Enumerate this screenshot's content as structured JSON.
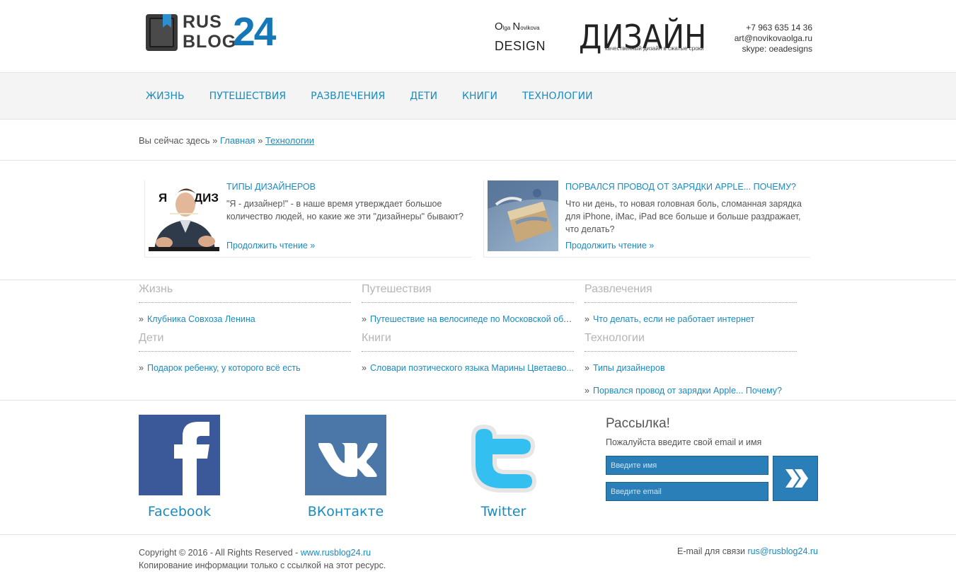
{
  "logo": {
    "rus": "RUS",
    "blog": "BLOG",
    "num": "24",
    "brand_color": "#1577b8"
  },
  "banner": {
    "name_O": "O",
    "name_lga": "lga",
    "name_N": "N",
    "name_ovikova": "ovikova",
    "design": "DESIGN",
    "title": "ДИЗАЙН",
    "slogan": "качественный дизайн в сжатые сроки",
    "phone": "+7 963 635 14 36",
    "email": "art@novikovaolga.ru",
    "skype": "skype: oeadesigns"
  },
  "nav": [
    "ЖИЗНЬ",
    "ПУТЕШЕСТВИЯ",
    "РАЗВЛЕЧЕНИЯ",
    "ДЕТИ",
    "КНИГИ",
    "ТЕХНОЛОГИИ"
  ],
  "breadcrumb": {
    "prefix": "Вы сейчас здесь",
    "sep": "»",
    "home": "Главная",
    "current": "Технологии"
  },
  "featured": [
    {
      "title": "Типы дизайнеров",
      "text": "\"Я - дизайнер!\" - в наше время утверждает большое количество людей, но какие же эти \"дизайнеры\" бывают?",
      "more": "Продолжить чтение »",
      "thumb_caption_left": "Я",
      "thumb_caption_right": "ДИЗ"
    },
    {
      "title": "Порвался провод от зарядки Apple... Почему?",
      "text": "Что ни день, то новая головная боль, сломанная зарядка для iPhone, iMac, iPad все больше и больше раздражает, что делать?",
      "more": "Продолжить чтение »"
    }
  ],
  "categories": [
    {
      "title": "Жизнь",
      "items": [
        "Клубника Совхоза Ленина"
      ]
    },
    {
      "title": "Путешествия",
      "items": [
        "Путешествие на велосипеде по Московской обл..."
      ]
    },
    {
      "title": "Развлечения",
      "items": [
        "Что делать, если не работает интернет"
      ]
    },
    {
      "title": "Дети",
      "items": [
        "Подарок ребенку, у которого всё есть"
      ]
    },
    {
      "title": "Книги",
      "items": [
        "Словари поэтического языка Марины Цветаево..."
      ]
    },
    {
      "title": "Технологии",
      "items": [
        "Типы дизайнеров",
        "Порвался провод от зарядки Apple... Почему?"
      ]
    }
  ],
  "bullet": "»",
  "social": [
    {
      "label": "Facebook",
      "color": "#3b5998",
      "icon": "facebook-icon"
    },
    {
      "label": "ВКонтакте",
      "color": "#4a76a8",
      "icon": "vk-icon"
    },
    {
      "label": "Twitter",
      "color": "#33bff0",
      "icon": "twitter-icon"
    }
  ],
  "newsletter": {
    "title": "Рассылка!",
    "subtitle": "Пожалуйста введите свой email и имя",
    "name_placeholder": "Введите имя",
    "email_placeholder": "Введите email",
    "button_color": "#2a7fb8"
  },
  "footer": {
    "copyright": "Copyright © 2016 - All Rights Reserved -",
    "site": "www.rusblog24.ru",
    "notice": "Копирование информации только с ссылкой на этот ресурс.",
    "mail_label": "E-mail для связи",
    "mail": "rus@rusblog24.ru"
  }
}
